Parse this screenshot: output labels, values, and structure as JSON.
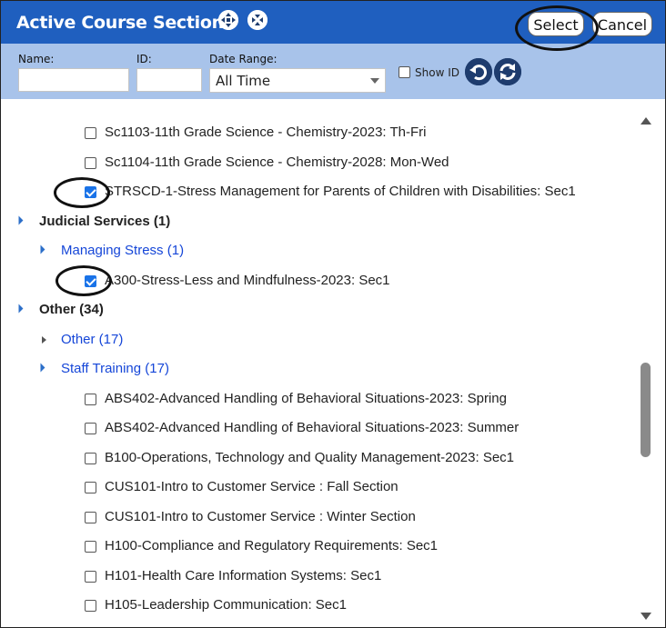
{
  "title": "Active Course Sections",
  "buttons": {
    "select": "Select",
    "cancel": "Cancel"
  },
  "filters": {
    "name_label": "Name:",
    "id_label": "ID:",
    "date_label": "Date Range:",
    "date_value": "All Time",
    "show_id_label": "Show ID"
  },
  "tree": {
    "items": [
      {
        "text": "Sc1103-11th Grade Science - Chemistry-2023: Th-Fri",
        "checked": false
      },
      {
        "text": "Sc1104-11th Grade Science - Chemistry-2028: Mon-Wed",
        "checked": false
      },
      {
        "text": "STRSCD-1-Stress Management for Parents of Children with Disabilities: Sec1",
        "checked": true
      },
      {
        "text": "Judicial Services (1)"
      },
      {
        "text": "Managing Stress (1)"
      },
      {
        "text": "A300-Stress-Less and Mindfulness-2023: Sec1",
        "checked": true
      },
      {
        "text": "Other (34)"
      },
      {
        "text": "Other (17)"
      },
      {
        "text": "Staff Training (17)"
      },
      {
        "text": "ABS402-Advanced Handling of Behavioral Situations-2023: Spring",
        "checked": false
      },
      {
        "text": "ABS402-Advanced Handling of Behavioral Situations-2023: Summer",
        "checked": false
      },
      {
        "text": "B100-Operations, Technology and Quality Management-2023: Sec1",
        "checked": false
      },
      {
        "text": "CUS101-Intro to Customer Service : Fall Section",
        "checked": false
      },
      {
        "text": "CUS101-Intro to Customer Service : Winter Section",
        "checked": false
      },
      {
        "text": "H100-Compliance and Regulatory Requirements: Sec1",
        "checked": false
      },
      {
        "text": "H101-Health Care Information Systems: Sec1",
        "checked": false
      },
      {
        "text": "H105-Leadership Communication: Sec1",
        "checked": false
      }
    ]
  },
  "colors": {
    "header": "#1f5fbf",
    "filterbar": "#a8c3ea",
    "link": "#1546d8",
    "checked": "#1a73e8"
  },
  "icons": [
    "expand-all-icon",
    "collapse-all-icon",
    "undo-icon",
    "refresh-icon"
  ]
}
